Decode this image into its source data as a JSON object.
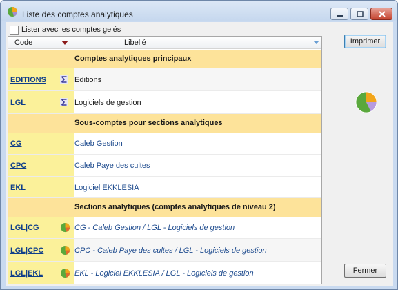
{
  "window": {
    "title": "Liste des comptes analytiques",
    "icon": "pie-chart-icon"
  },
  "options": {
    "frozen_accounts_label": "Lister avec les comptes gelés",
    "frozen_accounts_checked": false
  },
  "grid": {
    "columns": {
      "code": "Code",
      "libelle": "Libellé"
    },
    "sections": [
      {
        "label": "Comptes analytiques principaux",
        "rows": [
          {
            "code": "EDITIONS",
            "icon": "sigma-icon",
            "libelle": "Editions"
          },
          {
            "code": "LGL",
            "icon": "sigma-icon",
            "libelle": "Logiciels de gestion"
          }
        ]
      },
      {
        "label": "Sous-comptes pour sections analytiques",
        "rows": [
          {
            "code": "CG",
            "libelle": "Caleb Gestion"
          },
          {
            "code": "CPC",
            "libelle": "Caleb Paye des cultes"
          },
          {
            "code": "EKL",
            "libelle": "Logiciel EKKLESIA"
          }
        ]
      },
      {
        "label": "Sections analytiques (comptes analytiques de niveau 2)",
        "rows": [
          {
            "code": "LGL|CG",
            "icon": "pie-chart-icon",
            "libelle": "CG - Caleb Gestion / LGL - Logiciels de gestion"
          },
          {
            "code": "LGL|CPC",
            "icon": "pie-chart-icon",
            "libelle": "CPC - Caleb Paye des cultes / LGL - Logiciels de gestion"
          },
          {
            "code": "LGL|EKL",
            "icon": "pie-chart-icon",
            "libelle": "EKL - Logiciel EKKLESIA / LGL - Logiciels de gestion"
          }
        ]
      }
    ]
  },
  "buttons": {
    "print": "Imprimer",
    "close": "Fermer"
  },
  "colors": {
    "code_column": "#fbf19a",
    "section_row": "#fde39a",
    "link": "#0f3e8a",
    "libelle_text": "#1e4b8e"
  }
}
